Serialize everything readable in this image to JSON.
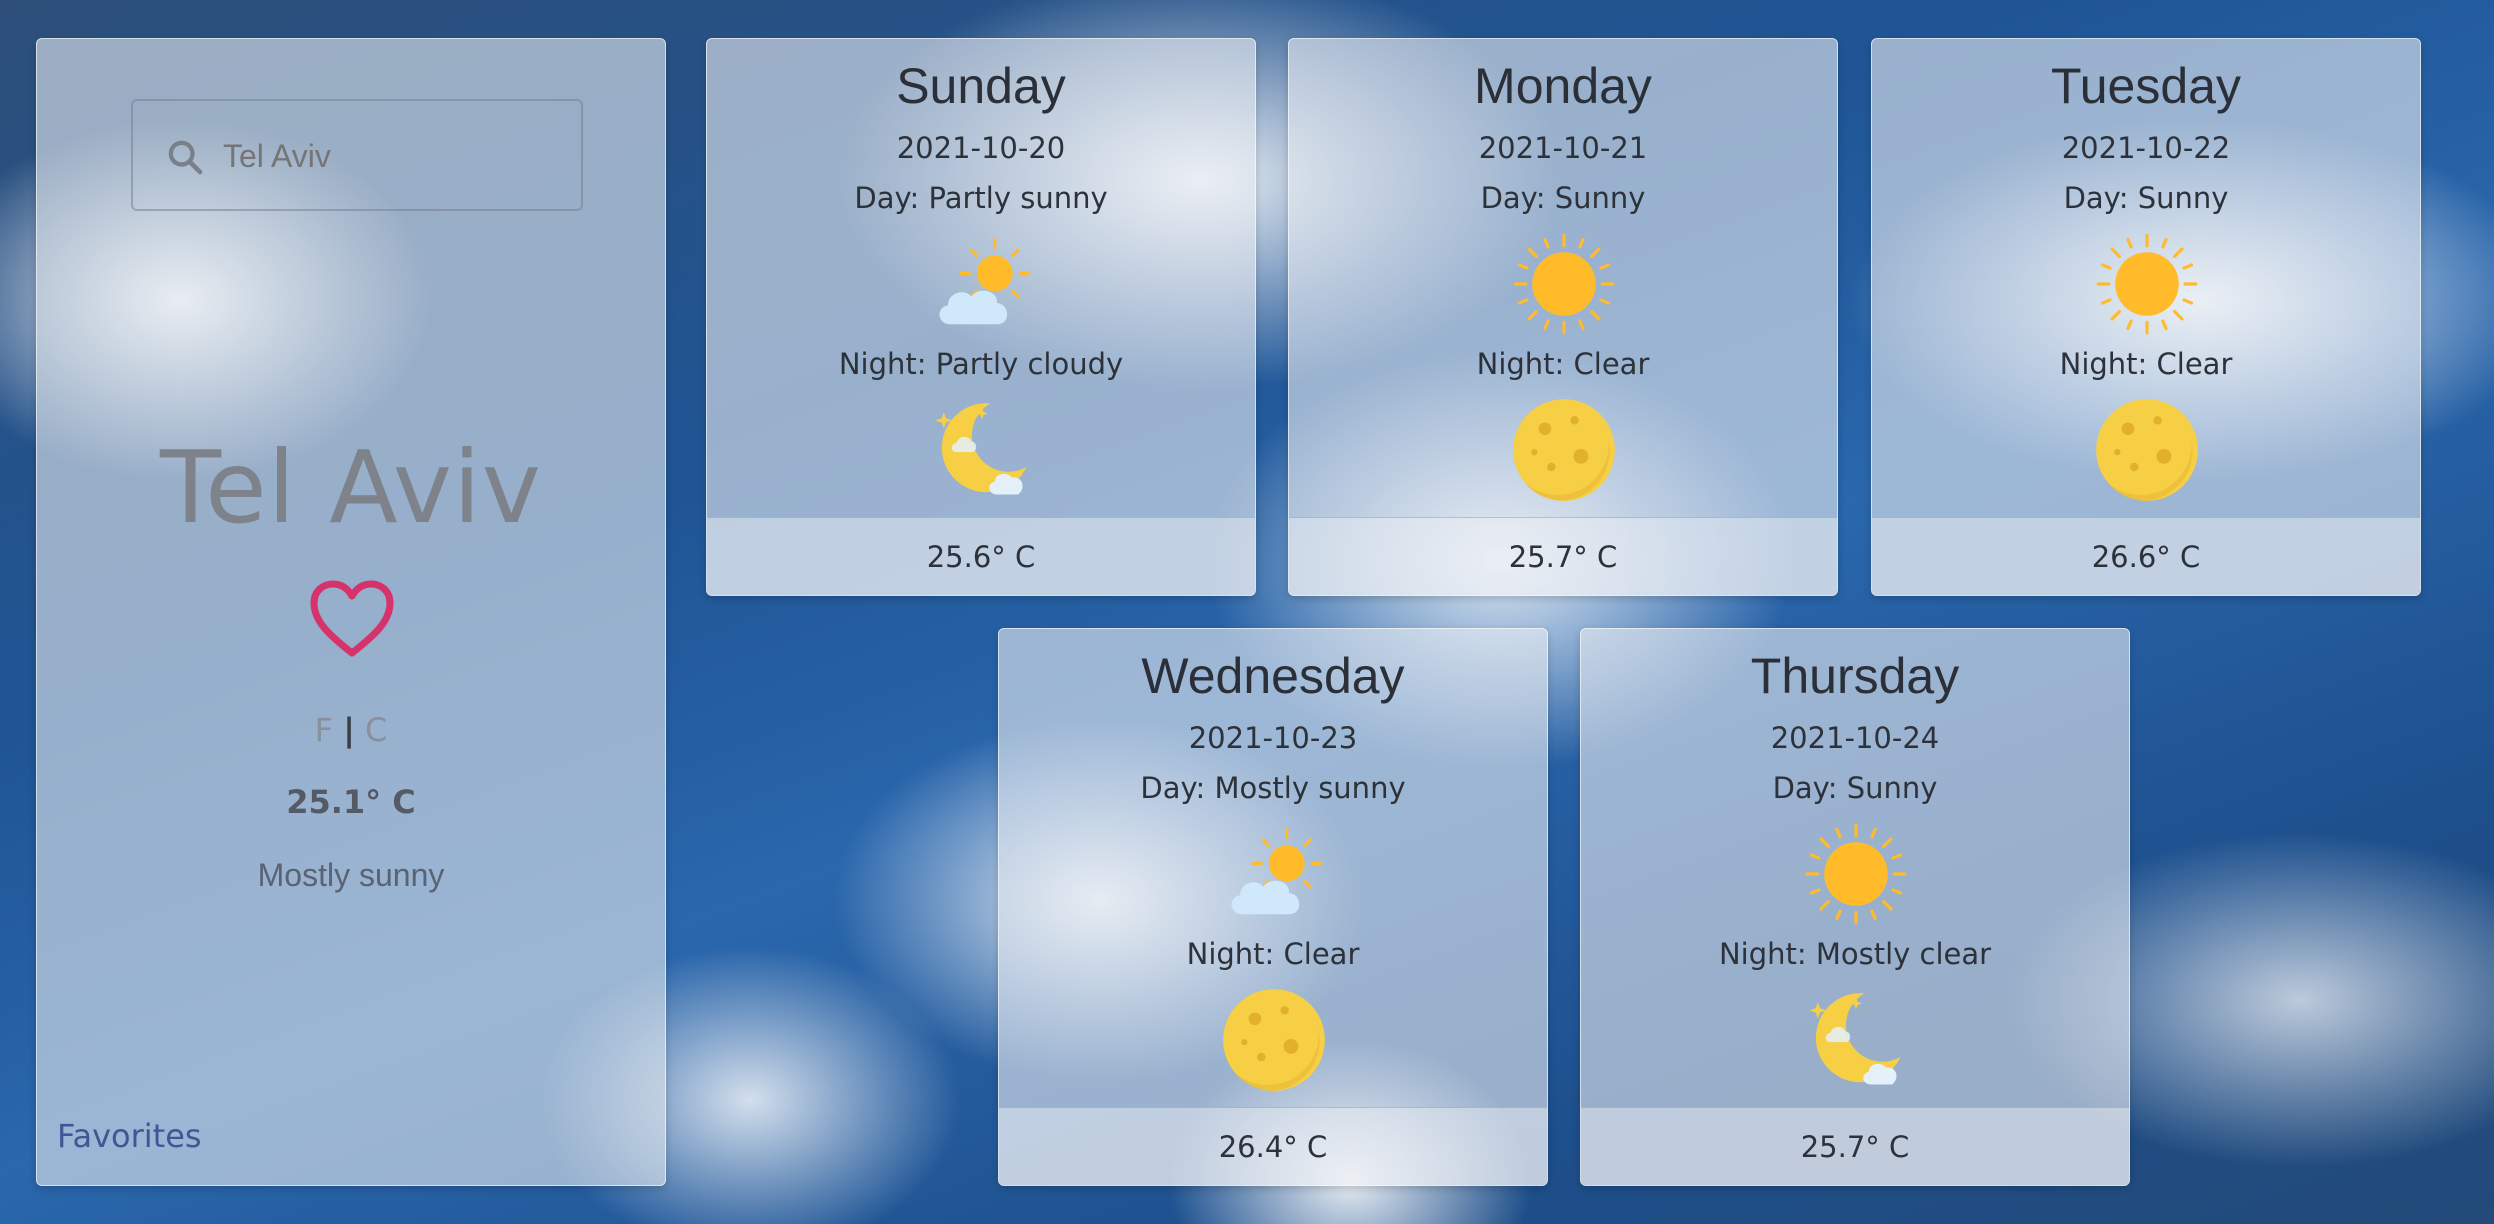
{
  "search": {
    "placeholder": "Tel Aviv",
    "value": "",
    "icon": "search-icon"
  },
  "city": {
    "name": "Tel Aviv",
    "favorite_icon": "heart-outline-icon",
    "favorite_color": "#d6336c",
    "unit_f": "F",
    "unit_sep": "|",
    "unit_c": "C",
    "temperature": "25.1° C",
    "condition": "Mostly sunny"
  },
  "nav": {
    "favorites": "Favorites"
  },
  "forecast": [
    {
      "day": "Sunday",
      "date": "2021-10-20",
      "day_cond": "Day: Partly sunny",
      "day_icon": "sun-behind-cloud-icon",
      "night_cond": "Night: Partly cloudy",
      "night_icon": "moon-with-cloud-icon",
      "temp": "25.6° C"
    },
    {
      "day": "Monday",
      "date": "2021-10-21",
      "day_cond": "Day: Sunny",
      "day_icon": "sun-icon",
      "night_cond": "Night: Clear",
      "night_icon": "full-moon-icon",
      "temp": "25.7° C"
    },
    {
      "day": "Tuesday",
      "date": "2021-10-22",
      "day_cond": "Day: Sunny",
      "day_icon": "sun-icon",
      "night_cond": "Night: Clear",
      "night_icon": "full-moon-icon",
      "temp": "26.6° C"
    },
    {
      "day": "Wednesday",
      "date": "2021-10-23",
      "day_cond": "Day: Mostly sunny",
      "day_icon": "sun-behind-cloud-icon",
      "night_cond": "Night: Clear",
      "night_icon": "full-moon-icon",
      "temp": "26.4° C"
    },
    {
      "day": "Thursday",
      "date": "2021-10-24",
      "day_cond": "Day: Sunny",
      "day_icon": "sun-icon",
      "night_cond": "Night: Mostly clear",
      "night_icon": "moon-with-cloud-icon",
      "temp": "25.7° C"
    }
  ],
  "colors": {
    "sun": "#ffbb29",
    "moon": "#f7cf45",
    "cloud": "#cfe9fb",
    "heart": "#d6336c",
    "link": "#3e5795"
  }
}
